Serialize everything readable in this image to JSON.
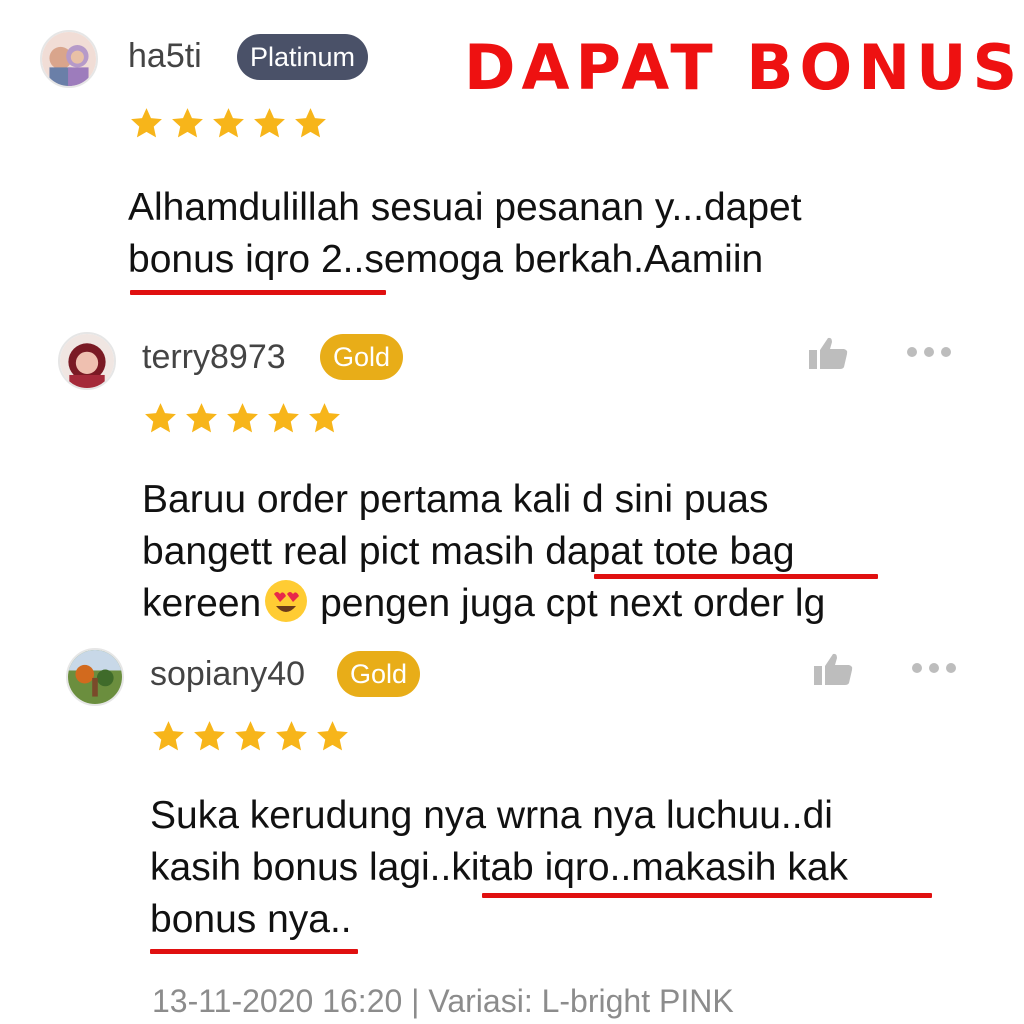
{
  "banner": "DAPAT BONUS",
  "reviews": [
    {
      "username": "ha5ti",
      "badge": "Platinum",
      "rating": 5,
      "lines": [
        "Alhamdulillah sesuai pesanan y...dapet",
        "bonus iqro 2..semoga berkah.Aamiin"
      ]
    },
    {
      "username": "terry8973",
      "badge": "Gold",
      "rating": 5,
      "lines": [
        "Baruu order pertama kali d sini puas",
        "bangett real pict masih dapat tote bag",
        "kereen",
        " pengen juga cpt next order lg"
      ]
    },
    {
      "username": "sopiany40",
      "badge": "Gold",
      "rating": 5,
      "lines": [
        "Suka kerudung nya wrna nya luchuu..di",
        "kasih bonus lagi..kitab iqro..makasih kak",
        "bonus nya.."
      ],
      "meta": "13-11-2020 16:20 | Variasi: L-bright PINK"
    }
  ],
  "colors": {
    "banner": "#ee1111",
    "platinum_badge": "#4a5168",
    "gold_badge": "#e8ad18",
    "star": "#f7b51a",
    "underline": "#e01010",
    "meta_text": "#8c8c8c"
  },
  "icons": [
    "star-icon",
    "thumbs-up-icon",
    "more-options-icon",
    "heart-eyes-emoji-icon"
  ]
}
